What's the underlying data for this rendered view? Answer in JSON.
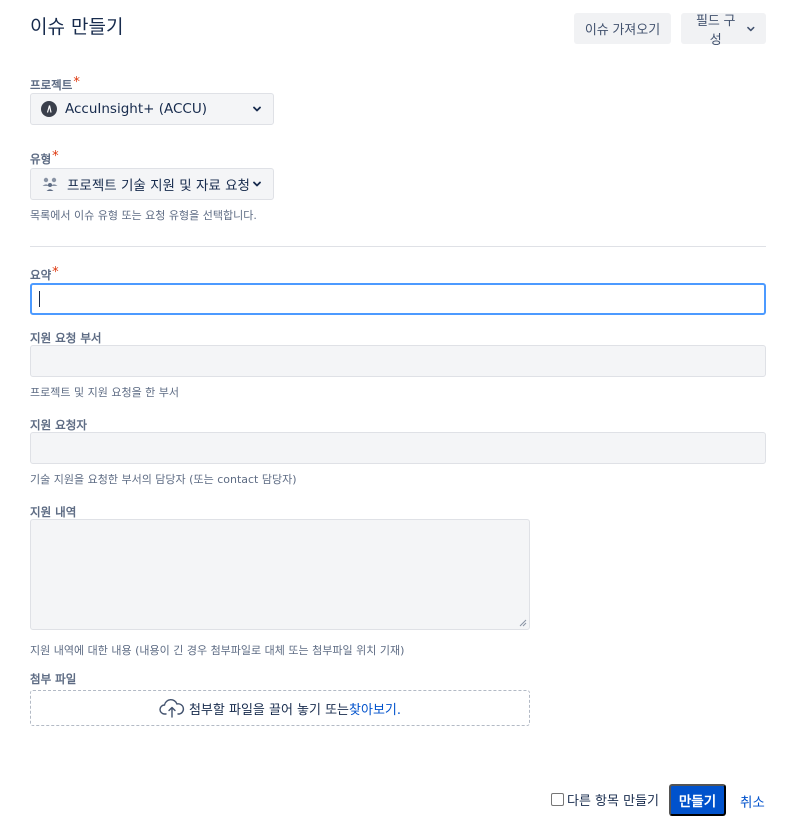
{
  "header": {
    "title": "이슈 만들기",
    "import_label": "이슈 가져오기",
    "configure_label": "필드 구성"
  },
  "required_marker": "*",
  "project": {
    "label": "프로젝트",
    "value": "AccuInsight+ (ACCU)"
  },
  "issue_type": {
    "label": "유형",
    "value": "프로젝트 기술 지원 및 자료 요청",
    "help": "목록에서 이슈 유형 또는 요청 유형을 선택합니다."
  },
  "summary": {
    "label": "요약",
    "value": ""
  },
  "department": {
    "label": "지원 요청 부서",
    "value": "",
    "help": "프로젝트 및 지원 요청을 한 부서"
  },
  "requester": {
    "label": "지원 요청자",
    "value": "",
    "help": "기술 지원을 요청한 부서의 담당자 (또는 contact 담당자)"
  },
  "details": {
    "label": "지원 내역",
    "value": "",
    "help": "지원 내역에 대한 내용 (내용이 긴 경우 첨부파일로 대체 또는 첨부파일 위치 기재)"
  },
  "attachment": {
    "label": "첨부 파일",
    "drop_text": "첨부할 파일을 끌어 놓기 또는 ",
    "browse_link": "찾아보기."
  },
  "footer": {
    "create_another_label": "다른 항목 만들기",
    "create_another_checked": false,
    "create_label": "만들기",
    "cancel_label": "취소"
  },
  "colors": {
    "primary": "#0052cc",
    "focus_border": "#4c9aff",
    "required": "#de350b"
  }
}
